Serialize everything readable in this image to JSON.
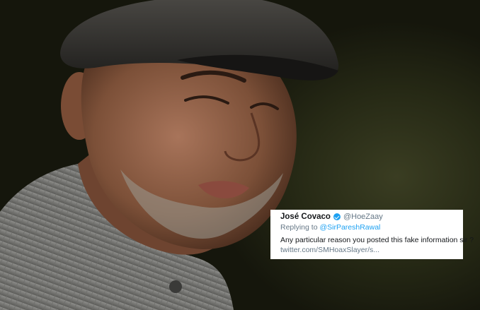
{
  "tweet": {
    "display_name": "José Covaco",
    "handle": "@HoeZaay",
    "replying_to_prefix": "Replying to",
    "replying_to_user": "@SirPareshRawal",
    "text": "Any particular reason you posted this fake information sir ?",
    "link": "twitter.com/SMHoaxSlayer/s...",
    "verified_color": "#1da1f2"
  },
  "photo": {
    "subject": "man-in-flat-cap-winking"
  }
}
